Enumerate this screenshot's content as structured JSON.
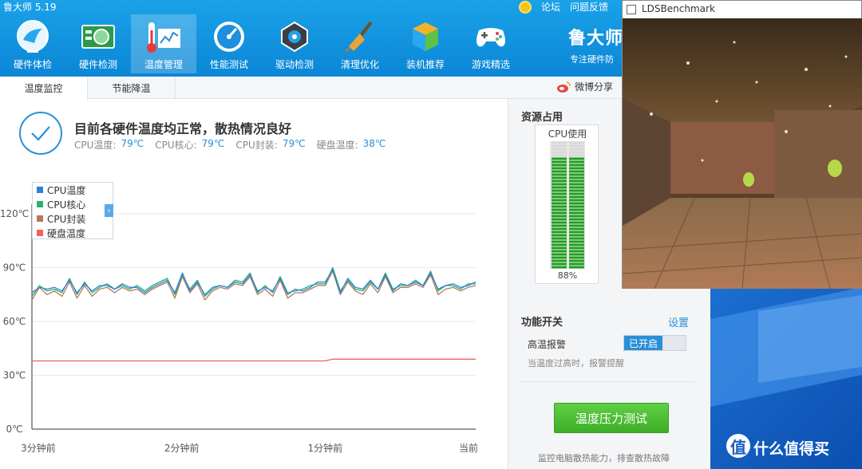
{
  "app": {
    "title": "鲁大师 5.19",
    "brand": "鲁大师",
    "brand_sub": "专注硬件防",
    "coin_label": "",
    "link_forum": "论坛",
    "link_feedback": "问题反馈"
  },
  "nav": [
    {
      "label": "硬件体检",
      "icon": "monitor-icon"
    },
    {
      "label": "硬件检测",
      "icon": "circuit-board-icon"
    },
    {
      "label": "温度管理",
      "icon": "thermometer-icon"
    },
    {
      "label": "性能测试",
      "icon": "speedometer-icon"
    },
    {
      "label": "驱动检测",
      "icon": "driver-gear-icon"
    },
    {
      "label": "清理优化",
      "icon": "broom-icon"
    },
    {
      "label": "装机推荐",
      "icon": "cube-icon"
    },
    {
      "label": "游戏精选",
      "icon": "gamepad-icon"
    }
  ],
  "tabs": {
    "temp_monitor": "温度监控",
    "power_saving": "节能降温",
    "share": "微博分享"
  },
  "status": {
    "title": "目前各硬件温度均正常，散热情况良好",
    "items": [
      {
        "label": "CPU温度:",
        "value": "79℃"
      },
      {
        "label": "CPU核心:",
        "value": "79℃"
      },
      {
        "label": "CPU封装:",
        "value": "79℃"
      },
      {
        "label": "硬盘温度:",
        "value": "38℃"
      }
    ]
  },
  "chart_data": {
    "type": "line",
    "title": "",
    "ylim": [
      0,
      120
    ],
    "yticks": [
      "0℃",
      "30℃",
      "60℃",
      "90℃",
      "120℃"
    ],
    "xticks": [
      "3分钟前",
      "2分钟前",
      "1分钟前",
      "当前"
    ],
    "x_count": 60,
    "series": [
      {
        "name": "CPU温度",
        "color": "#2f7fd8",
        "values": [
          76,
          79,
          78,
          79,
          77,
          83,
          76,
          81,
          77,
          80,
          80,
          78,
          81,
          79,
          79,
          76,
          79,
          81,
          83,
          76,
          87,
          77,
          82,
          75,
          79,
          80,
          79,
          82,
          81,
          86,
          77,
          79,
          77,
          84,
          75,
          78,
          77,
          79,
          82,
          82,
          89,
          76,
          84,
          79,
          78,
          83,
          78,
          86,
          77,
          81,
          80,
          82,
          80,
          87,
          78,
          80,
          81,
          79,
          80,
          82
        ]
      },
      {
        "name": "CPU核心",
        "color": "#27b36b",
        "values": [
          74,
          80,
          77,
          78,
          76,
          84,
          75,
          82,
          76,
          79,
          81,
          78,
          80,
          78,
          80,
          77,
          80,
          82,
          84,
          75,
          86,
          78,
          83,
          74,
          78,
          80,
          79,
          83,
          82,
          87,
          76,
          80,
          76,
          85,
          76,
          77,
          78,
          80,
          81,
          81,
          90,
          77,
          83,
          78,
          77,
          82,
          78,
          87,
          78,
          80,
          80,
          83,
          80,
          88,
          77,
          80,
          80,
          78,
          81,
          81
        ]
      },
      {
        "name": "CPU封装",
        "color": "#b5785a",
        "values": [
          72,
          79,
          75,
          77,
          74,
          82,
          73,
          80,
          74,
          78,
          79,
          76,
          79,
          77,
          78,
          75,
          78,
          80,
          82,
          73,
          85,
          76,
          81,
          72,
          77,
          79,
          78,
          81,
          80,
          85,
          75,
          78,
          74,
          83,
          73,
          76,
          76,
          78,
          80,
          80,
          88,
          75,
          82,
          77,
          75,
          81,
          76,
          85,
          76,
          79,
          79,
          81,
          79,
          86,
          75,
          78,
          79,
          77,
          79,
          80
        ]
      },
      {
        "name": "硬盘温度",
        "color": "#f06060",
        "values": [
          38,
          38,
          38,
          38,
          38,
          38,
          38,
          38,
          38,
          38,
          38,
          38,
          38,
          38,
          38,
          38,
          38,
          38,
          38,
          38,
          38,
          38,
          38,
          38,
          38,
          38,
          38,
          38,
          38,
          38,
          38,
          38,
          38,
          38,
          38,
          38,
          38,
          38,
          38,
          38,
          39,
          39,
          39,
          39,
          39,
          39,
          39,
          39,
          39,
          39,
          39,
          39,
          39,
          39,
          39,
          39,
          39,
          39,
          39,
          39
        ]
      }
    ],
    "grid": true,
    "legend": "top-left"
  },
  "resource": {
    "title": "资源占用",
    "cpu_label": "CPU使用",
    "cpu_percent": 88,
    "cpu_text": "88%"
  },
  "functions": {
    "title": "功能开关",
    "settings": "设置",
    "alarm_label": "高温报警",
    "alarm_state": "已开启",
    "alarm_desc": "当温度过高时，报警提醒"
  },
  "stress": {
    "button": "温度压力测试",
    "desc": "监控电脑散热能力，排查散热故障"
  },
  "benchmark": {
    "title": "LDSBenchmark"
  },
  "watermark": {
    "logo": "值",
    "text": "什么值得买"
  },
  "colors": {
    "accent": "#2b8fd6",
    "title_bar": "#1196e0",
    "stress_green": "#4cbc35",
    "cpu_bar": "#1fa01f"
  }
}
